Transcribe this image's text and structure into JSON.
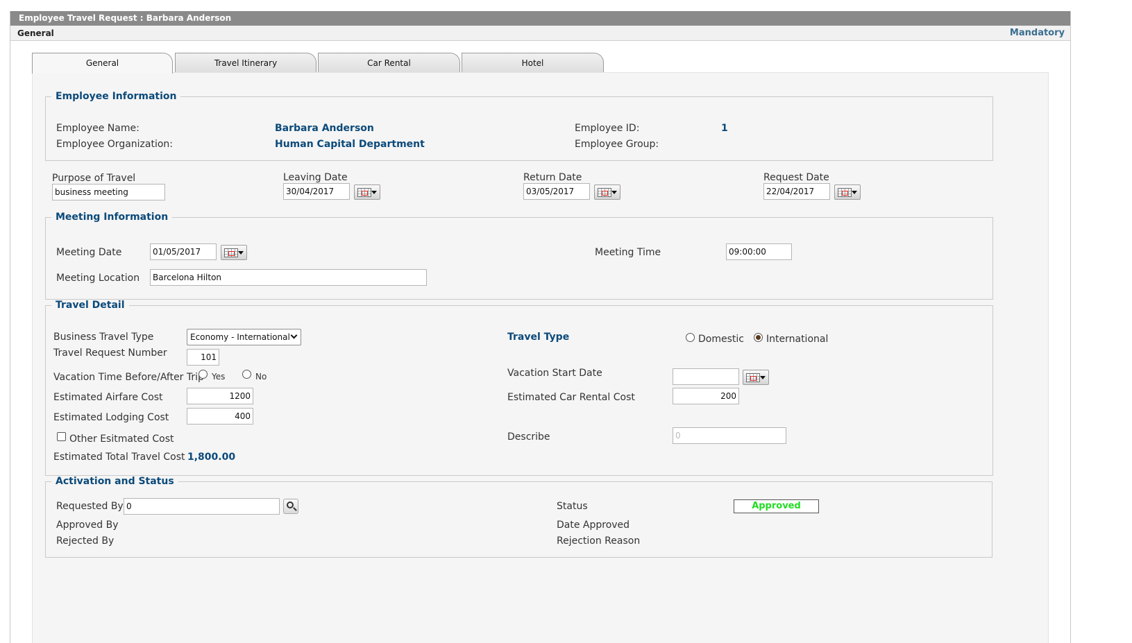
{
  "window": {
    "title": "Employee Travel Request : Barbara Anderson",
    "section": "General",
    "mandatory": "Mandatory"
  },
  "tabs": [
    "General",
    "Travel Itinerary",
    "Car Rental",
    "Hotel"
  ],
  "employee_info": {
    "legend": "Employee Information",
    "name_label": "Employee Name:",
    "name_value": "Barbara Anderson",
    "org_label": "Employee Organization:",
    "org_value": "Human Capital Department",
    "id_label": "Employee ID:",
    "id_value": "1",
    "group_label": "Employee Group:",
    "group_value": ""
  },
  "request": {
    "purpose_label": "Purpose of Travel",
    "purpose_value": "business meeting",
    "leaving_label": "Leaving Date",
    "leaving_value": "30/04/2017",
    "return_label": "Return Date",
    "return_value": "03/05/2017",
    "request_label": "Request Date",
    "request_value": "22/04/2017"
  },
  "meeting": {
    "legend": "Meeting Information",
    "date_label": "Meeting Date",
    "date_value": "01/05/2017",
    "time_label": "Meeting Time",
    "time_value": "09:00:00",
    "location_label": "Meeting Location",
    "location_value": "Barcelona Hilton"
  },
  "travel": {
    "legend": "Travel Detail",
    "business_type_label": "Business Travel Type",
    "business_type_value": "Economy - International",
    "travel_type_label": "Travel Type",
    "domestic_label": "Domestic",
    "international_label": "International",
    "travel_type_selected": "International",
    "request_number_label": "Travel Request Number",
    "request_number_value": "101",
    "vacation_label": "Vacation Time Before/After Trip",
    "yes_label": "Yes",
    "no_label": "No",
    "vacation_start_label": "Vacation Start Date",
    "vacation_start_value": "",
    "airfare_label": "Estimated Airfare Cost",
    "airfare_value": "1200",
    "car_rental_label": "Estimated Car Rental Cost",
    "car_rental_value": "200",
    "lodging_label": "Estimated Lodging Cost",
    "lodging_value": "400",
    "other_label": "Other Esitmated Cost",
    "describe_label": "Describe",
    "describe_placeholder": "0",
    "total_label": "Estimated Total Travel Cost",
    "total_value": "1,800.00"
  },
  "activation": {
    "legend": "Activation and Status",
    "requested_by_label": "Requested By",
    "requested_by_value": "0",
    "approved_by_label": "Approved By",
    "rejected_by_label": "Rejected By",
    "status_label": "Status",
    "status_value": "Approved",
    "status_color": "#22dd22",
    "date_approved_label": "Date Approved",
    "rejection_reason_label": "Rejection Reason"
  },
  "icons": {
    "calendar": "calendar-icon",
    "search": "search-icon",
    "dropdown": "chevron-down-icon"
  }
}
